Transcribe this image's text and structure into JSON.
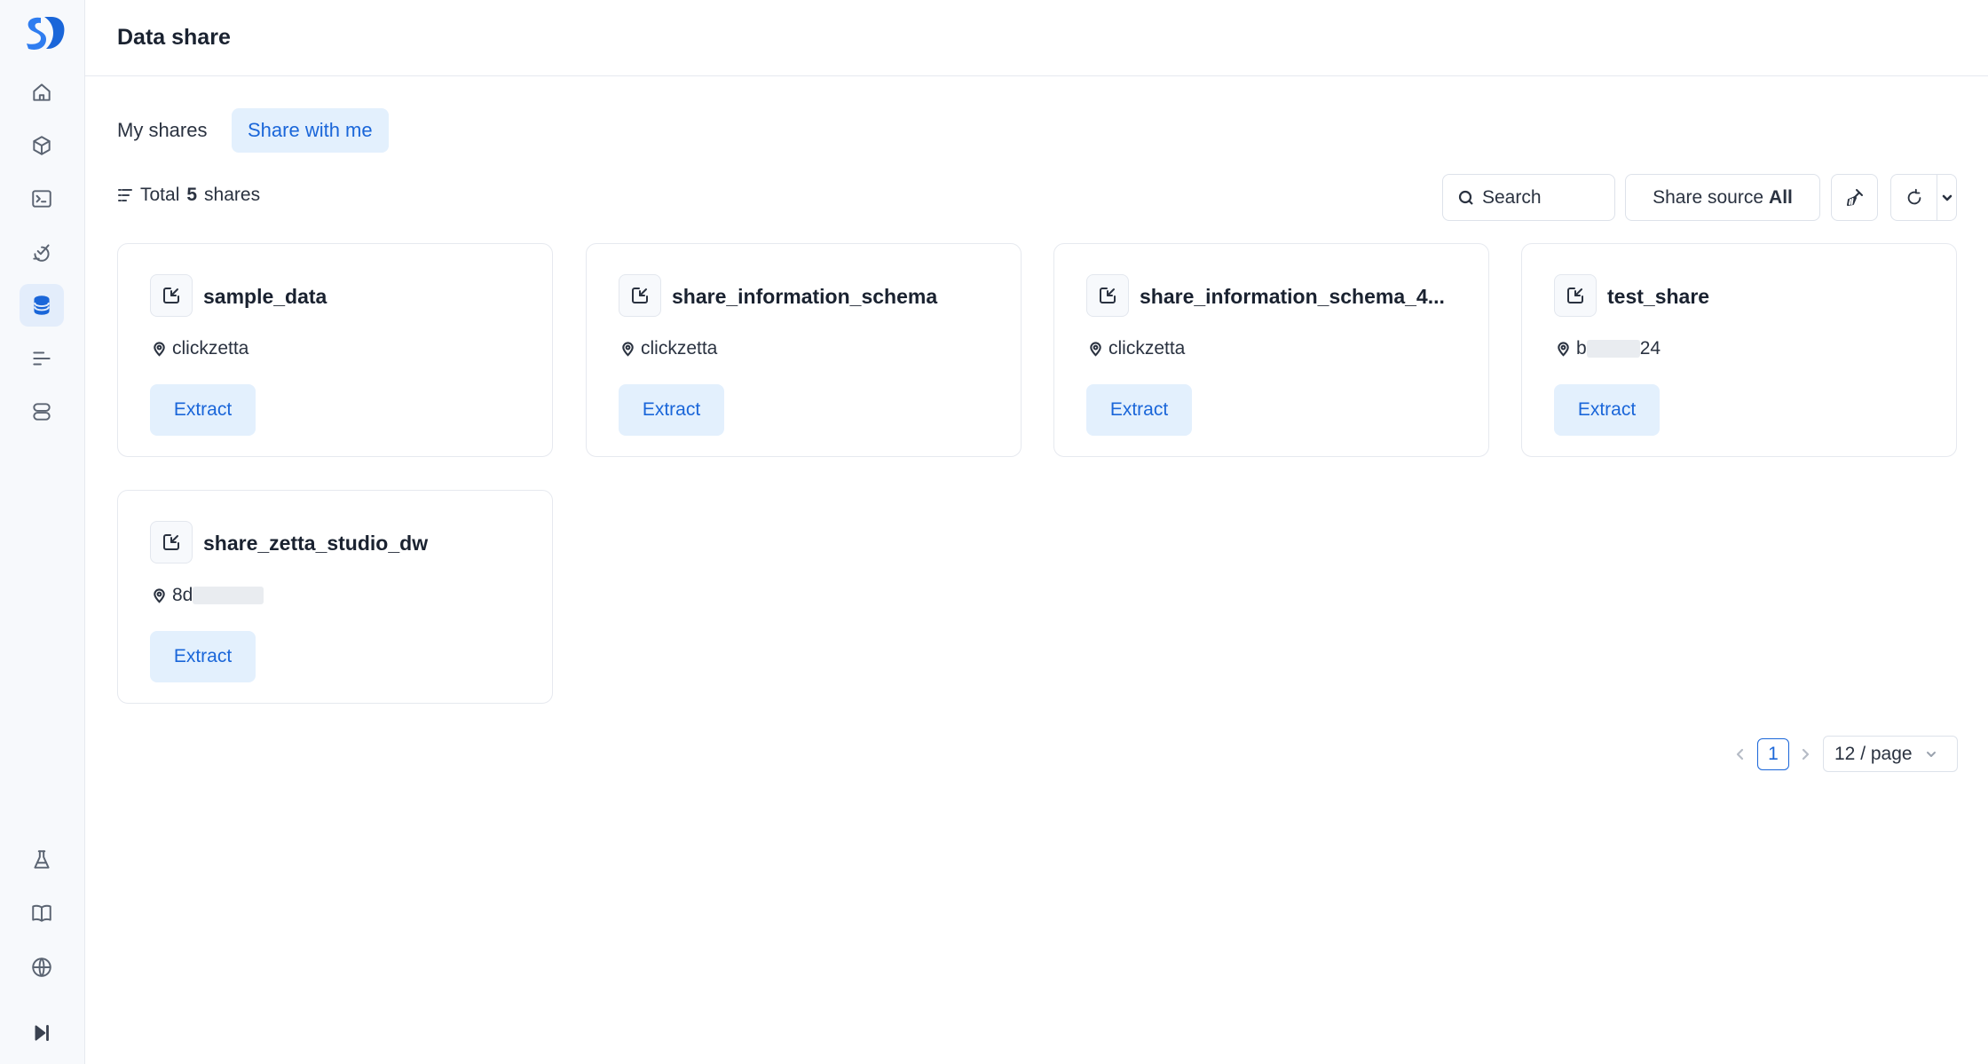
{
  "app": {
    "logo": "logo-icon"
  },
  "sidebar": {
    "top_items": [
      {
        "icon": "home-icon"
      },
      {
        "icon": "cube-icon"
      },
      {
        "icon": "terminal-icon"
      },
      {
        "icon": "task-icon"
      },
      {
        "icon": "database-icon",
        "active": true
      },
      {
        "icon": "list-icon"
      },
      {
        "icon": "server-icon"
      }
    ],
    "bottom_items": [
      {
        "icon": "flask-icon"
      },
      {
        "icon": "book-icon"
      },
      {
        "icon": "globe-icon"
      },
      {
        "icon": "collapse-sidebar-icon"
      }
    ]
  },
  "header": {
    "title": "Data share"
  },
  "tabs": [
    {
      "label": "My shares",
      "active": false
    },
    {
      "label": "Share with me",
      "active": true
    }
  ],
  "toolbar": {
    "total_prefix": "Total",
    "total_count": "5",
    "total_suffix": "shares",
    "search_placeholder": "Search",
    "share_source_label": "Share source",
    "share_source_value": "All"
  },
  "cards": [
    {
      "name": "sample_data",
      "source": "clickzetta",
      "action": "Extract"
    },
    {
      "name": "share_information_schema",
      "source": "clickzetta",
      "action": "Extract"
    },
    {
      "name": "share_information_schema_4...",
      "source": "clickzetta",
      "action": "Extract"
    },
    {
      "name": "test_share",
      "source_start": "b",
      "source_end": "24",
      "action": "Extract"
    },
    {
      "name": "share_zetta_studio_dw",
      "source_start": "8d",
      "source_end": "",
      "action": "Extract"
    }
  ],
  "pagination": {
    "current_page": "1",
    "page_size": "12 / page"
  },
  "colors": {
    "accent": "#1a66d9",
    "accent_bg": "#e3f0fd",
    "sidebar_bg": "#f7f9fc",
    "border": "#e6e9ef"
  }
}
